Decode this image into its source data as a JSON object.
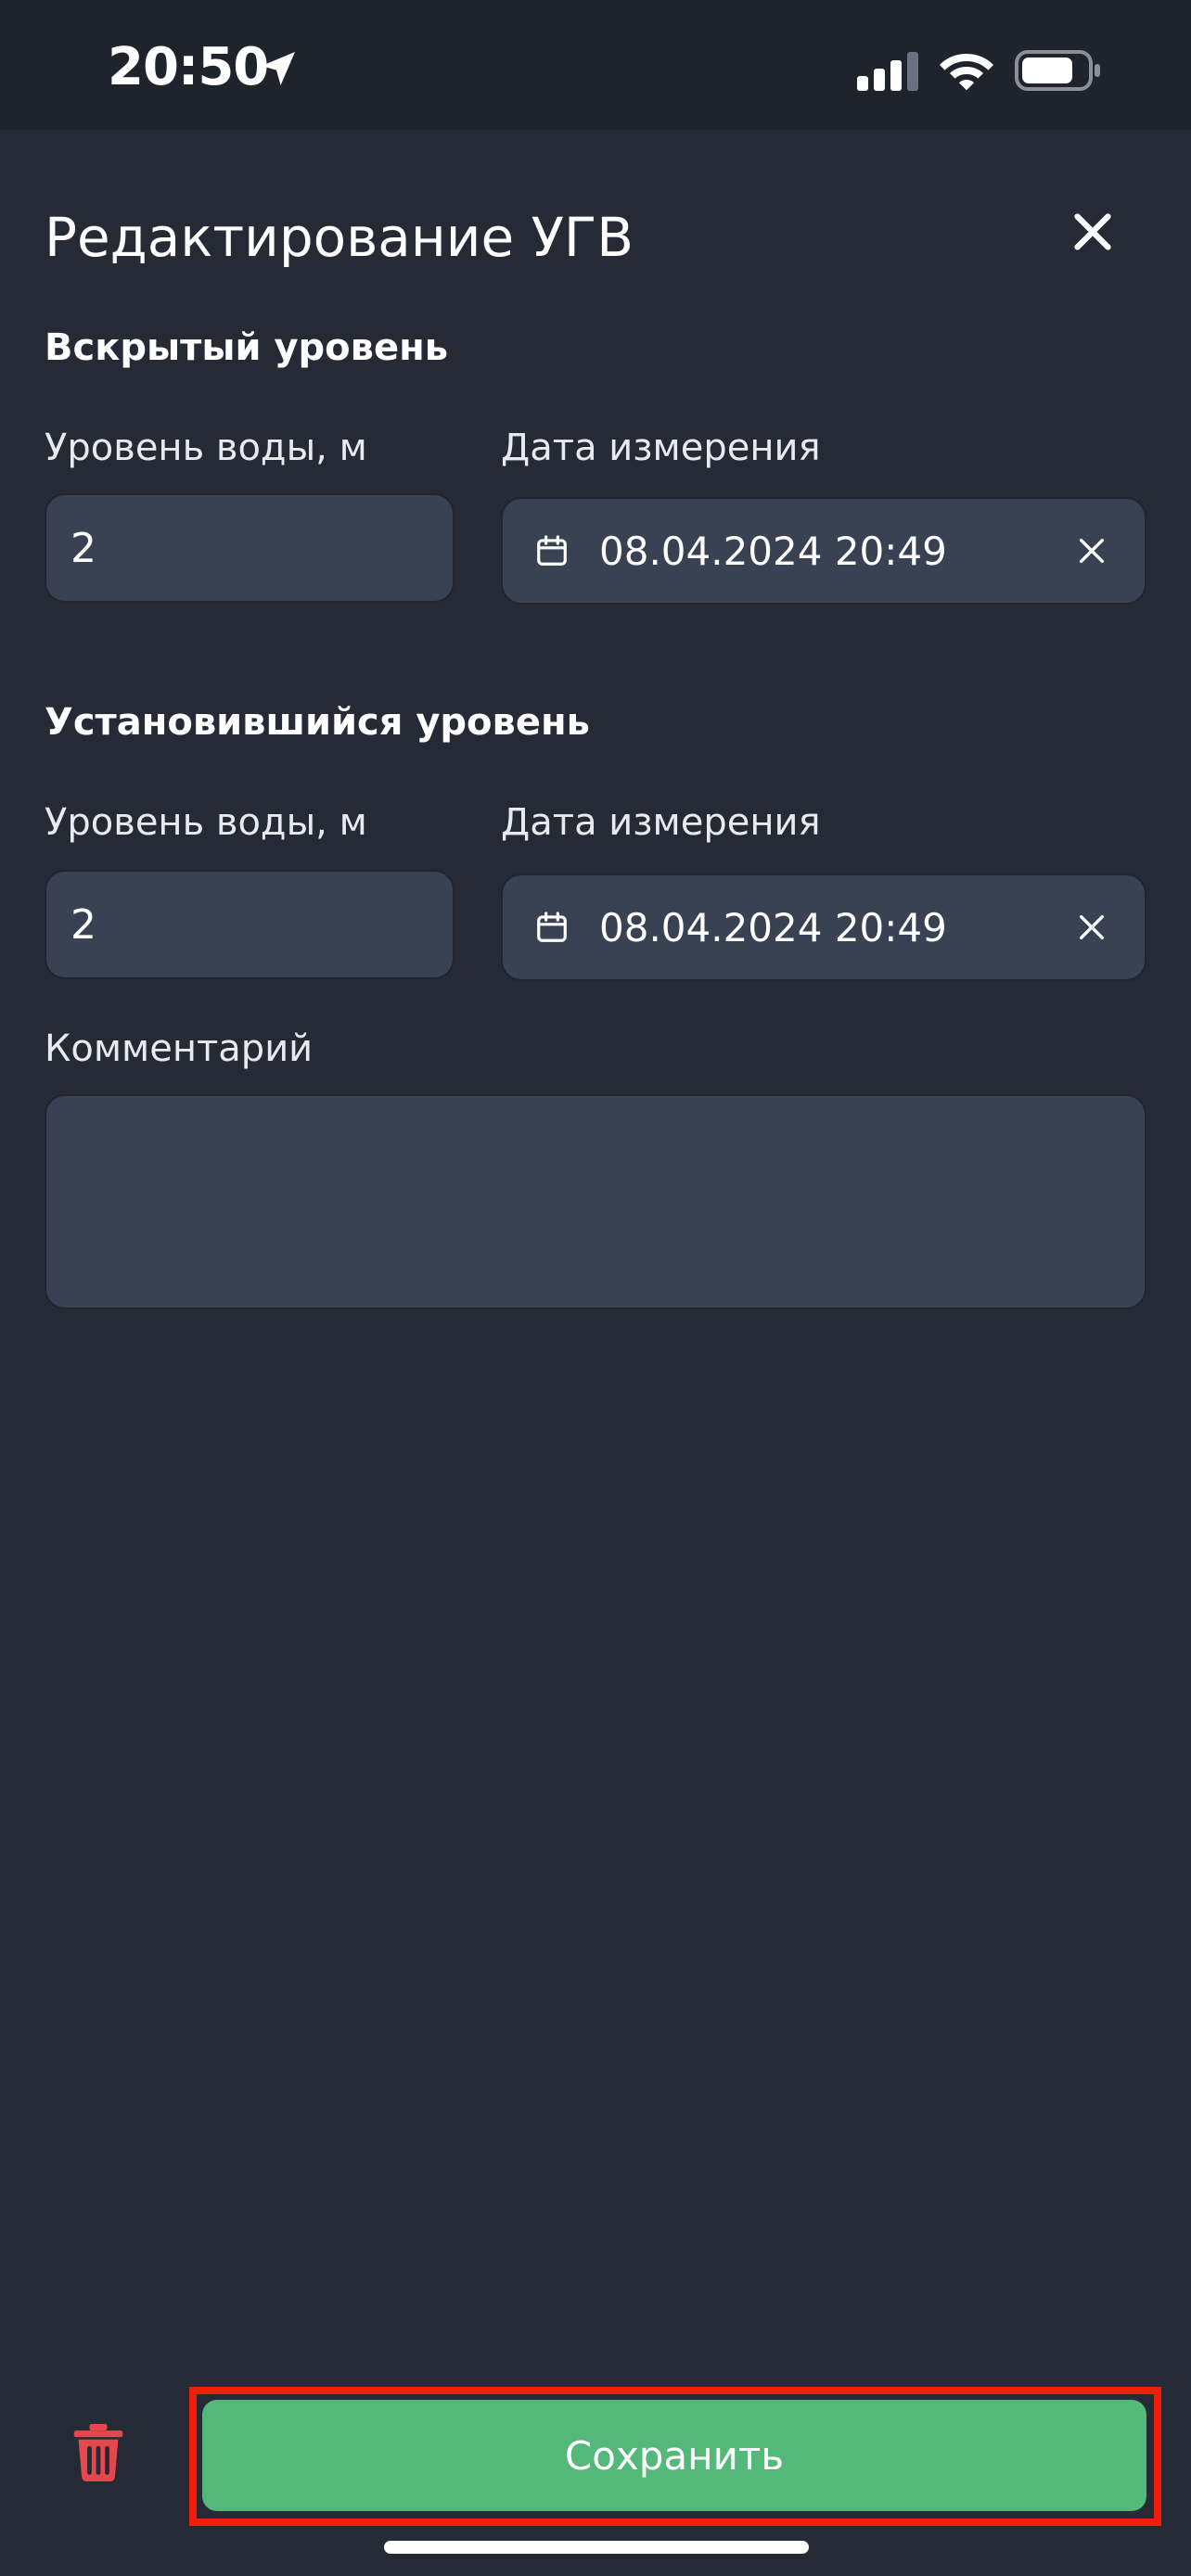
{
  "status_bar": {
    "time": "20:50"
  },
  "header": {
    "title": "Редактирование УГВ"
  },
  "sections": [
    {
      "title": "Вскрытый уровень",
      "water_level_label": "Уровень воды, м",
      "water_level_value": "2",
      "date_label": "Дата измерения",
      "date_value": "08.04.2024 20:49"
    },
    {
      "title": "Установившийся уровень",
      "water_level_label": "Уровень воды, м",
      "water_level_value": "2",
      "date_label": "Дата измерения",
      "date_value": "08.04.2024 20:49"
    }
  ],
  "comment": {
    "label": "Комментарий",
    "value": ""
  },
  "footer": {
    "save_label": "Сохранить"
  },
  "colors": {
    "background": "#252a35",
    "input_bg": "#394253",
    "save_button": "#55b87b",
    "delete_icon": "#e5474d",
    "highlight_outline": "#f21d0a"
  }
}
